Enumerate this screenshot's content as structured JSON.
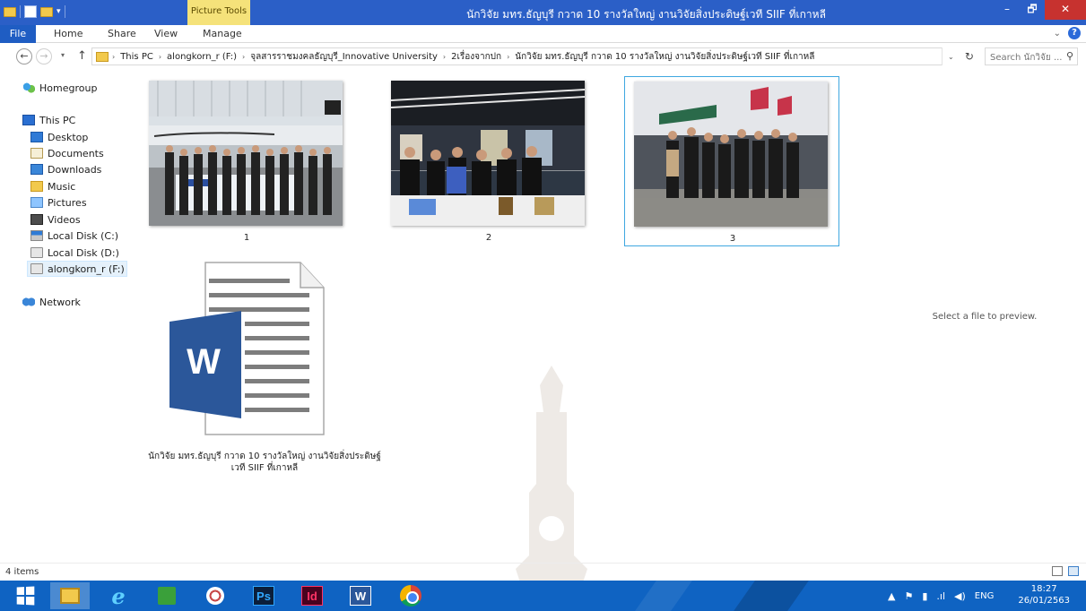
{
  "window": {
    "title": "นักวิจัย มทร.ธัญบุรี กวาด 10 รางวัลใหญ่ งานวิจัยสิ่งประดิษฐ์เวที SIIF ที่เกาหลี",
    "context_tab": "Picture Tools",
    "minimize": "–",
    "maximize": "🗗",
    "close": "✕"
  },
  "ribbon": {
    "tabs": [
      "File",
      "Home",
      "Share",
      "View",
      "Manage"
    ],
    "expand": "⌄",
    "help": "?"
  },
  "address": {
    "back": "←",
    "forward": "→",
    "recent": "▾",
    "up": "↑",
    "crumbs": [
      "This PC",
      "alongkorn_r (F:)",
      "จุลสารราชมงคลธัญบุรี_Innovative University",
      "2เรื่องจากปก",
      "นักวิจัย มทร.ธัญบุรี กวาด 10 รางวัลใหญ่ งานวิจัยสิ่งประดิษฐ์เวที SIIF ที่เกาหลี"
    ],
    "separator": "›",
    "dropdown": "⌄",
    "refresh": "↻",
    "search_placeholder": "Search นักวิจัย ...",
    "search_glyph": "⚲"
  },
  "nav_pane": {
    "homegroup": "Homegroup",
    "this_pc": "This PC",
    "items": [
      "Desktop",
      "Documents",
      "Downloads",
      "Music",
      "Pictures",
      "Videos",
      "Local Disk (C:)",
      "Local Disk (D:)",
      "alongkorn_r (F:)"
    ],
    "network": "Network"
  },
  "files": [
    {
      "name": "1",
      "type": "image"
    },
    {
      "name": "2",
      "type": "image"
    },
    {
      "name": "3",
      "type": "image",
      "selected": true
    },
    {
      "name_line1": "นักวิจัย มทร.ธัญบุรี กวาด 10 รางวัลใหญ่ งานวิจัยสิ่งประดิษฐ์",
      "name_line2": "เวที SIIF ที่เกาหลี",
      "type": "word-document",
      "icon_letter": "W"
    }
  ],
  "preview": {
    "message": "Select a file to preview."
  },
  "status": {
    "item_count": "4 items"
  },
  "taskbar": {
    "apps": [
      "start",
      "file-explorer",
      "internet-explorer",
      "store",
      "snipping-tool",
      "photoshop",
      "indesign",
      "word",
      "chrome"
    ],
    "ie_glyph": "e",
    "ps_label": "Ps",
    "id_label": "Id",
    "word_label": "W",
    "tray_up": "▲",
    "tray_flag": "⚑",
    "tray_net": "▮",
    "tray_signal": ".ıl",
    "tray_volume": "◀)",
    "language": "ENG",
    "time": "18:27",
    "date": "26/01/2563"
  },
  "colors": {
    "titlebar": "#2b5fc7",
    "context_tab": "#f5e27a",
    "close_button": "#c7322f",
    "taskbar": "#0f63c2",
    "selection_border": "#3fa7e0",
    "word_blue": "#2b579a"
  }
}
